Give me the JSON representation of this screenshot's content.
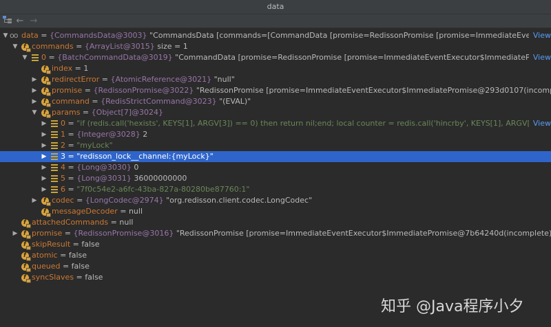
{
  "window": {
    "title": "data"
  },
  "toolbar": {
    "back_icon": "←",
    "forward_icon": "→"
  },
  "rows": [
    {
      "name": "data",
      "sep": " = ",
      "type": "{CommandsData@3003} ",
      "value": "\"CommandsData [commands=[CommandData [promise=RedissonPromise [promise=ImmediateEventExecutor$Immec",
      "view": "View"
    },
    {
      "name": "commands",
      "sep": " = ",
      "type": "{ArrayList@3015} ",
      "value": " size = 1"
    },
    {
      "name": "0",
      "sep": " = ",
      "type": "{BatchCommandData@3019} ",
      "value": "\"CommandData [promise=RedissonPromise [promise=ImmediateEventExecutor$ImmediatePromise@293d010",
      "view": "View"
    },
    {
      "name": "index",
      "sep": " = ",
      "type": "",
      "value": "1"
    },
    {
      "name": "redirectError",
      "sep": " = ",
      "type": "{AtomicReference@3021} ",
      "value": "\"null\""
    },
    {
      "name": "promise",
      "sep": " = ",
      "type": "{RedissonPromise@3022} ",
      "value": "\"RedissonPromise [promise=ImmediateEventExecutor$ImmediatePromise@293d0107(incomplete)]\""
    },
    {
      "name": "command",
      "sep": " = ",
      "type": "{RedisStrictCommand@3023} ",
      "value": "\"(EVAL)\""
    },
    {
      "name": "params",
      "sep": " = ",
      "type": "{Object[7]@3024}",
      "value": ""
    },
    {
      "name": "0",
      "sep": " = ",
      "type": "",
      "value": "\"if (redis.call('hexists', KEYS[1], ARGV[3]) == 0) then return nil;end; local counter = redis.call('hincrby', KEYS[1], ARGV[3], -1); if (cou",
      "view": "View"
    },
    {
      "name": "1",
      "sep": " = ",
      "type": "{Integer@3028} ",
      "value": "2"
    },
    {
      "name": "2",
      "sep": " = ",
      "type": "",
      "value": "\"myLock\""
    },
    {
      "name": "3",
      "sep": " = ",
      "type": "",
      "value": "\"redisson_lock__channel:{myLock}\""
    },
    {
      "name": "4",
      "sep": " = ",
      "type": "{Long@3030} ",
      "value": "0"
    },
    {
      "name": "5",
      "sep": " = ",
      "type": "{Long@3031} ",
      "value": "36000000000"
    },
    {
      "name": "6",
      "sep": " = ",
      "type": "",
      "value": "\"7f0c54e2-a6fc-43ba-827a-80280be87760:1\""
    },
    {
      "name": "codec",
      "sep": " = ",
      "type": "{LongCodec@2974} ",
      "value": "\"org.redisson.client.codec.LongCodec\""
    },
    {
      "name": "messageDecoder",
      "sep": " = ",
      "type": "",
      "value": "null"
    },
    {
      "name": "attachedCommands",
      "sep": " = ",
      "type": "",
      "value": "null"
    },
    {
      "name": "promise",
      "sep": " = ",
      "type": "{RedissonPromise@3016} ",
      "value": "\"RedissonPromise [promise=ImmediateEventExecutor$ImmediatePromise@7b64240d(incomplete)]\""
    },
    {
      "name": "skipResult",
      "sep": " = ",
      "type": "",
      "value": "false"
    },
    {
      "name": "atomic",
      "sep": " = ",
      "type": "",
      "value": "false"
    },
    {
      "name": "queued",
      "sep": " = ",
      "type": "",
      "value": "false"
    },
    {
      "name": "syncSlaves",
      "sep": " = ",
      "type": "",
      "value": "false"
    }
  ],
  "watermark": "知乎 @Java程序小夕"
}
